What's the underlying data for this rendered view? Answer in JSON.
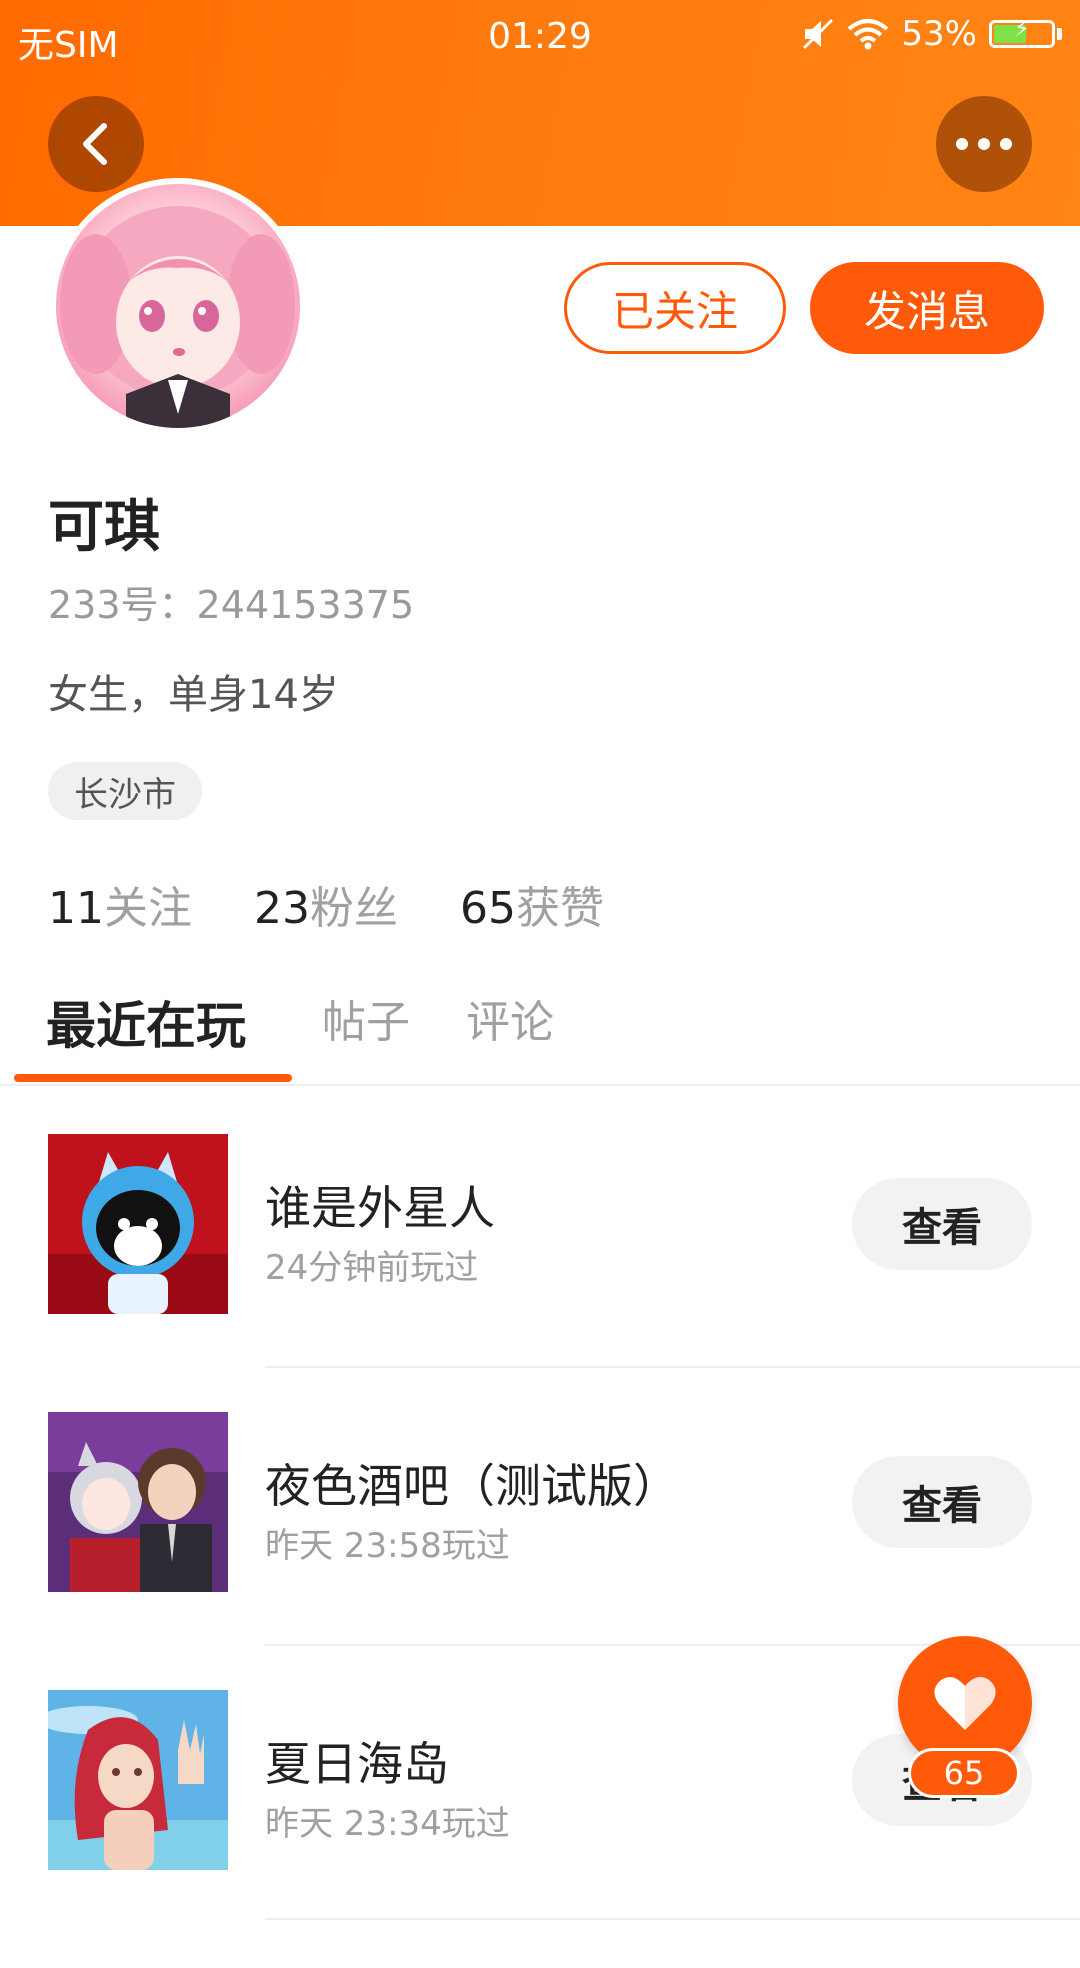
{
  "status_bar": {
    "carrier": "无SIM",
    "time": "01:29",
    "battery_percent": "53%",
    "icons": [
      "mute-icon",
      "wifi-icon",
      "battery-icon"
    ]
  },
  "header": {
    "gradient_colors": [
      "#ff6a00",
      "#ff8514"
    ],
    "back_icon": "chevron-left-icon",
    "more_icon": "ellipsis-icon"
  },
  "profile": {
    "name": "可琪",
    "id_text": "233号：244153375",
    "bio": "女生，单身14岁",
    "location": "长沙市",
    "follow_state_label": "已关注",
    "message_label": "发消息",
    "accent_color": "#ff5a0a"
  },
  "stats": [
    {
      "value": "11",
      "label": "关注"
    },
    {
      "value": "23",
      "label": "粉丝"
    },
    {
      "value": "65",
      "label": "获赞"
    }
  ],
  "tabs": [
    "最近在玩",
    "帖子",
    "评论"
  ],
  "games": [
    {
      "title": "谁是外星人",
      "time": "24分钟前玩过",
      "action": "查看"
    },
    {
      "title": "夜色酒吧（测试版）",
      "time": "昨天 23:58玩过",
      "action": "查看"
    },
    {
      "title": "夏日海岛",
      "time": "昨天 23:34玩过",
      "action": "查看"
    }
  ],
  "like_fab": {
    "count": "65",
    "icon": "heart-icon"
  }
}
